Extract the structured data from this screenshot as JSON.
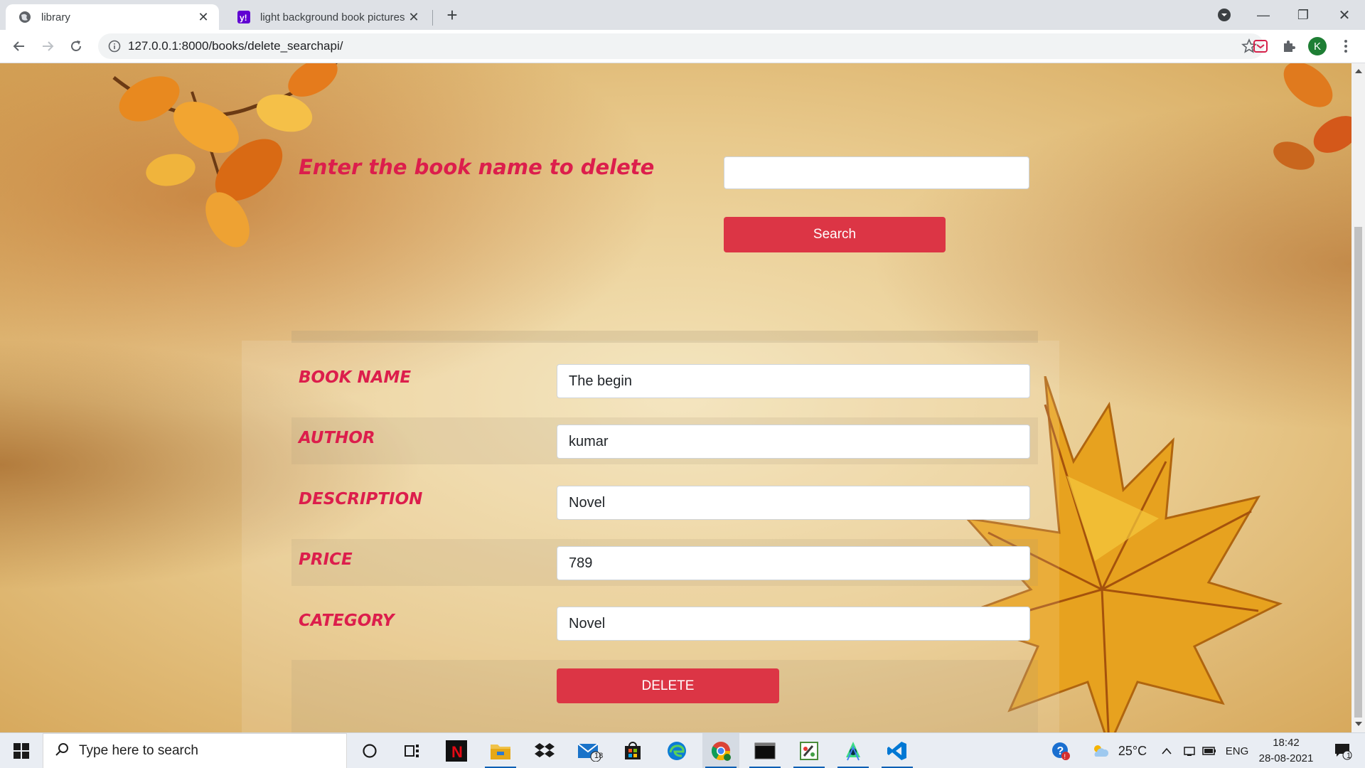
{
  "browser": {
    "tabs": [
      {
        "title": "library",
        "active": true,
        "icon": "globe-icon"
      },
      {
        "title": "light background book pictures -",
        "active": false,
        "icon": "yahoo-icon"
      }
    ],
    "url": "127.0.0.1:8000/books/delete_searchapi/",
    "profile_initial": "K"
  },
  "search": {
    "heading": "Enter the book name to delete",
    "input_value": "",
    "button_label": "Search"
  },
  "book": {
    "fields": [
      {
        "label": "BOOK NAME",
        "value": "The begin"
      },
      {
        "label": "AUTHOR",
        "value": "kumar"
      },
      {
        "label": "DESCRIPTION",
        "value": "Novel"
      },
      {
        "label": "PRICE",
        "value": "789"
      },
      {
        "label": "CATEGORY",
        "value": "Novel"
      }
    ],
    "delete_label": "DELETE"
  },
  "taskbar": {
    "search_placeholder": "Type here to search",
    "mail_badge": "18",
    "weather": "25°C",
    "language": "ENG",
    "time": "18:42",
    "date": "28-08-2021",
    "notification_count": "1"
  },
  "colors": {
    "accent_red": "#dc3545",
    "label_red": "#dc1e4c"
  }
}
